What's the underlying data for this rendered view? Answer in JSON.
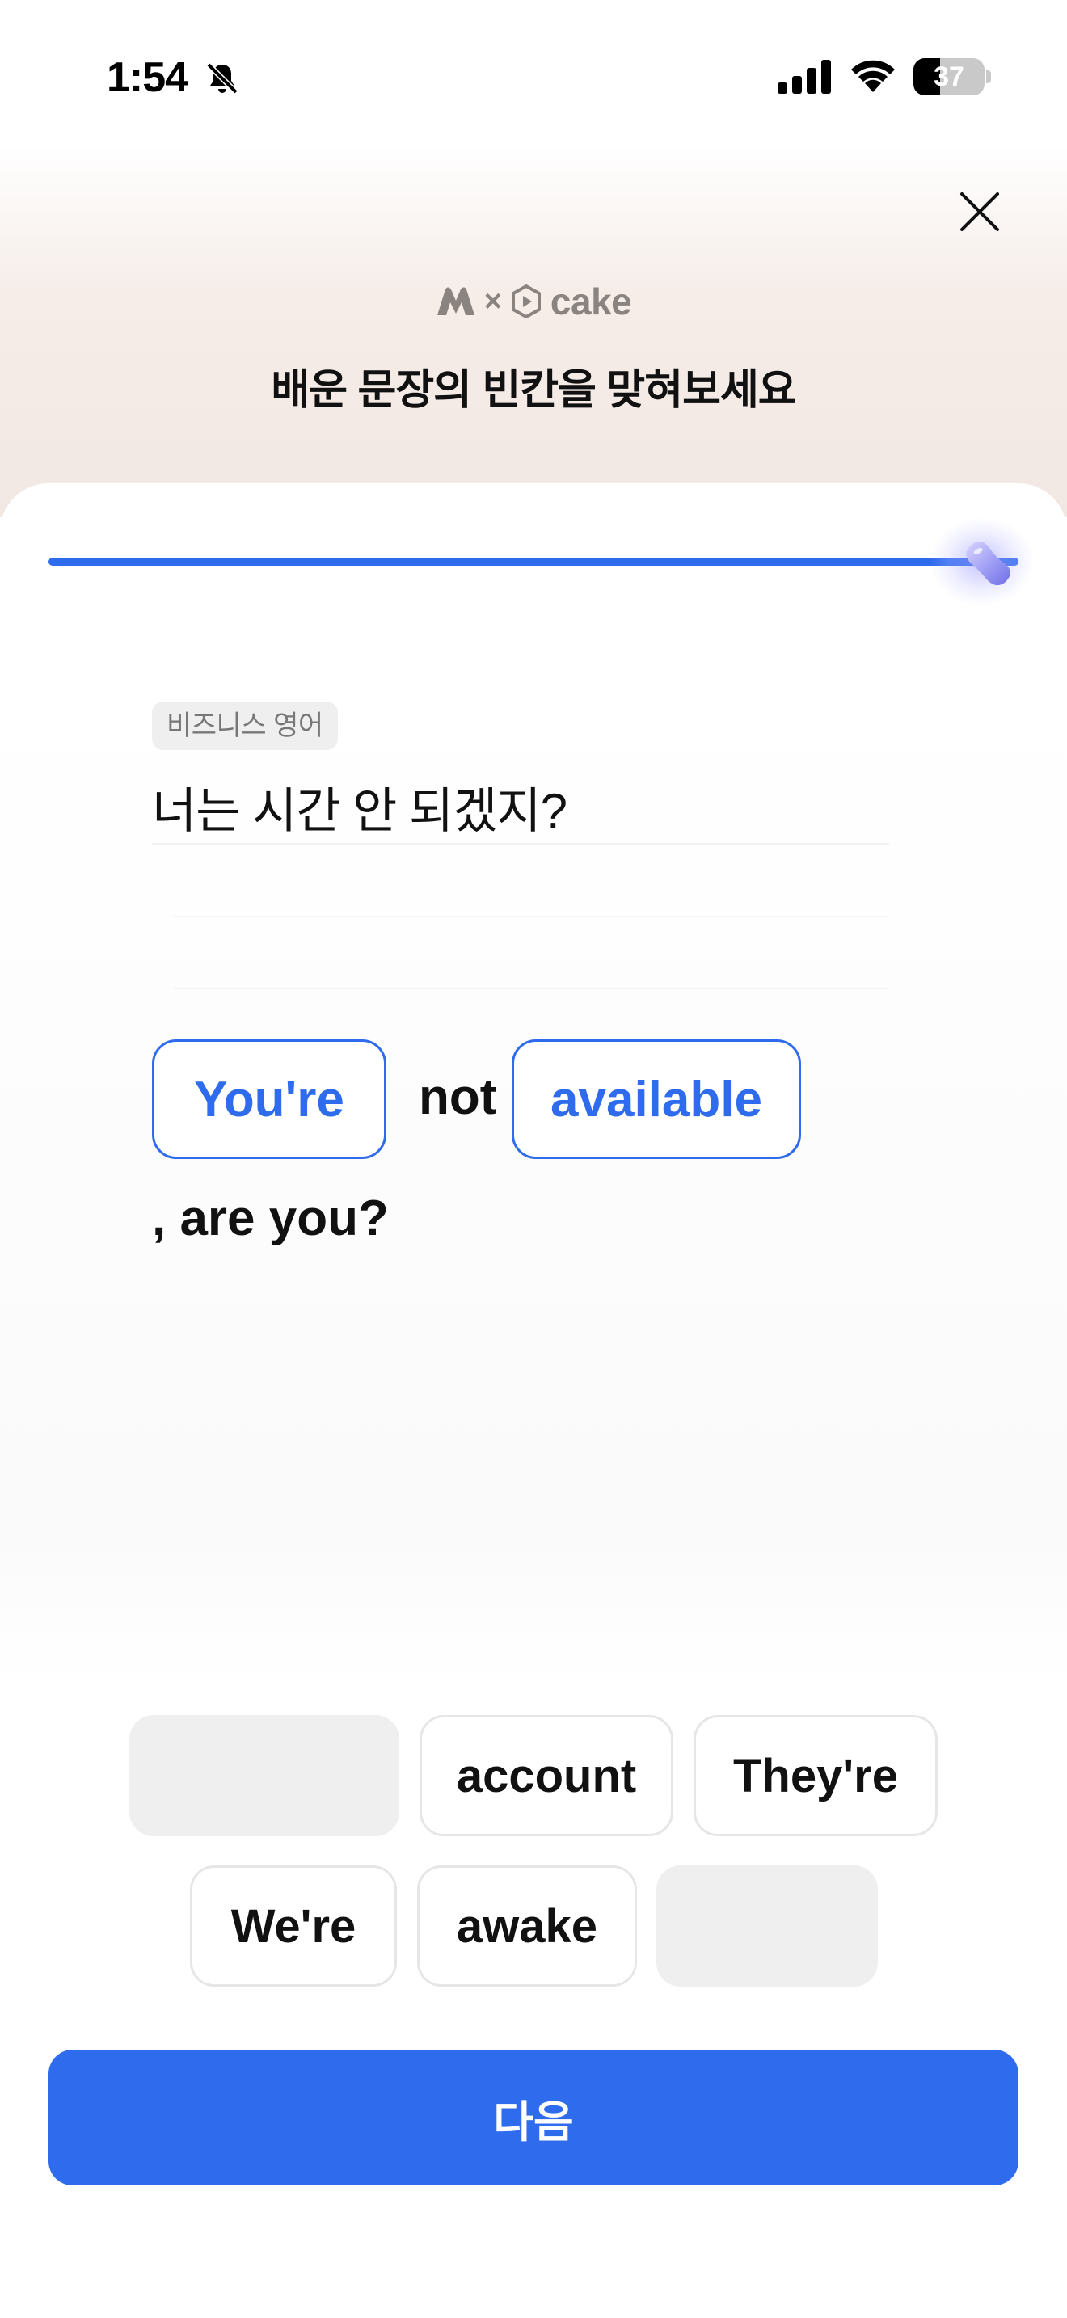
{
  "status_bar": {
    "time": "1:54",
    "battery": "37",
    "battery_level": 0.37
  },
  "header": {
    "brand_connector": "×",
    "brand_name": "cake",
    "title": "배운 문장의 빈칸을 맞혀보세요"
  },
  "progress": {
    "value": 1.0
  },
  "question": {
    "category": "비즈니스 영어",
    "korean": "너는 시간 안 되겠지?"
  },
  "answer": {
    "slot1": "You're",
    "word_between": "not",
    "slot2": "available",
    "ending": ", are you?"
  },
  "options": [
    {
      "label": "",
      "used": true
    },
    {
      "label": "account",
      "used": false
    },
    {
      "label": "They're",
      "used": false
    },
    {
      "label": "We're",
      "used": false
    },
    {
      "label": "awake",
      "used": false
    },
    {
      "label": "",
      "used": true
    }
  ],
  "next_button": "다음",
  "colors": {
    "accent": "#2f6bed",
    "header_bg": "#f1e7e3"
  }
}
